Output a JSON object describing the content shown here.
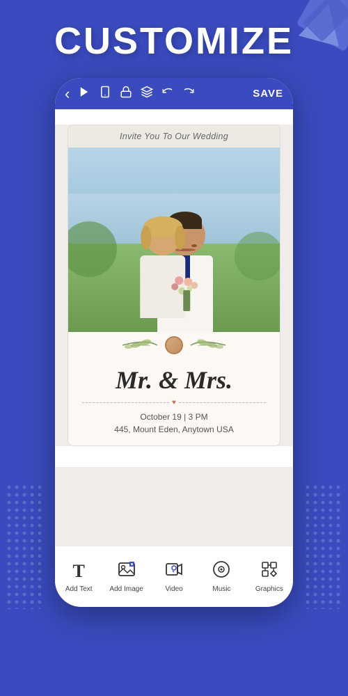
{
  "page": {
    "title": "CUSTOMIZE",
    "background_color": "#3a4bbf"
  },
  "toolbar": {
    "back_label": "‹",
    "save_label": "SAVE",
    "icons": [
      "play",
      "phone",
      "lock",
      "layers",
      "undo",
      "redo"
    ]
  },
  "card": {
    "header_text": "Invite You To Our Wedding",
    "mr_mrs_text": "Mr. & Mrs.",
    "date_text": "October 19 | 3 PM",
    "address_text": "445, Mount Eden, Anytown USA"
  },
  "bottom_nav": {
    "items": [
      {
        "id": "add-text",
        "label": "Add Text",
        "icon": "T"
      },
      {
        "id": "add-image",
        "label": "Add Image",
        "icon": "img"
      },
      {
        "id": "video",
        "label": "Video",
        "icon": "vid"
      },
      {
        "id": "music",
        "label": "Music",
        "icon": "mus"
      },
      {
        "id": "graphics",
        "label": "Graphics",
        "icon": "gfx"
      }
    ]
  }
}
